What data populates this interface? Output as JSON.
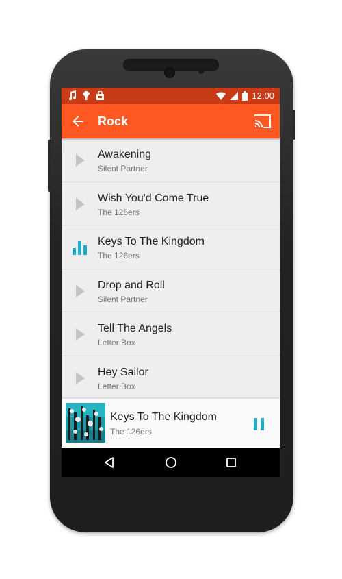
{
  "status_bar": {
    "time": "12:00",
    "icons": [
      "music-note-icon",
      "android-debug-icon",
      "shopping-bag-icon",
      "wifi-icon",
      "signal-icon",
      "battery-icon"
    ]
  },
  "app_bar": {
    "title": "Rock",
    "back_icon": "arrow-left-icon",
    "cast_icon": "cast-icon",
    "background_color": "#ff5722",
    "status_color": "#c83b17"
  },
  "tracks": [
    {
      "title": "Awakening",
      "artist": "Silent Partner",
      "state": "play"
    },
    {
      "title": "Wish You'd Come True",
      "artist": "The 126ers",
      "state": "play"
    },
    {
      "title": "Keys To The Kingdom",
      "artist": "The 126ers",
      "state": "playing"
    },
    {
      "title": "Drop and Roll",
      "artist": "Silent Partner",
      "state": "play"
    },
    {
      "title": "Tell The Angels",
      "artist": "Letter Box",
      "state": "play"
    },
    {
      "title": "Hey Sailor",
      "artist": "Letter Box",
      "state": "play"
    }
  ],
  "now_playing": {
    "title": "Keys To The Kingdom",
    "artist": "The 126ers",
    "control_icon": "pause-icon",
    "accent_color": "#26a9c4"
  },
  "nav_bar": {
    "items": [
      "back-triangle-icon",
      "home-circle-icon",
      "recents-square-icon"
    ]
  }
}
